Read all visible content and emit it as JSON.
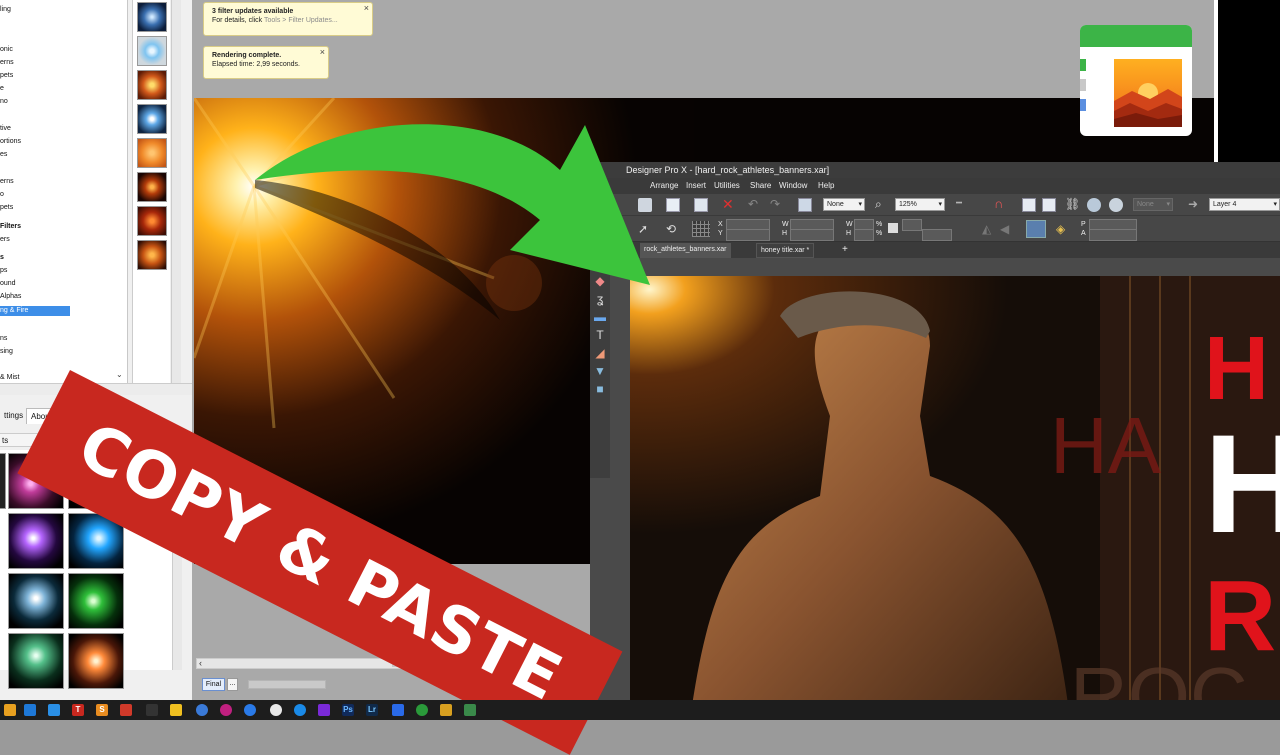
{
  "left_panel": {
    "categories": [
      {
        "label": "ling"
      },
      {
        "label": "onic"
      },
      {
        "label": "erns"
      },
      {
        "label": "pets"
      },
      {
        "label": "e"
      },
      {
        "label": "no"
      },
      {
        "label": "tive"
      },
      {
        "label": "ortions"
      },
      {
        "label": "es"
      },
      {
        "label": "erns"
      },
      {
        "label": "o"
      },
      {
        "label": "pets"
      },
      {
        "label": "Filters"
      },
      {
        "label": "ers"
      },
      {
        "label": "s"
      },
      {
        "label": "ps"
      },
      {
        "label": "ound"
      },
      {
        "label": "Alphas"
      },
      {
        "label": "ng & Fire"
      },
      {
        "label": "ns"
      },
      {
        "label": "sing"
      },
      {
        "label": "& Mist"
      }
    ],
    "tabs": {
      "settings": "ttings",
      "about": "About"
    },
    "presets_label": "ts"
  },
  "notifications": [
    {
      "title": "3 filter updates available",
      "body": "For details, click ",
      "link": "Tools > Filter Updates..."
    },
    {
      "title": "Rendering complete.",
      "body": "Elapsed time: 2,99 seconds."
    }
  ],
  "bottom_bar": {
    "final_label": "Final",
    "more_label": "..."
  },
  "designer": {
    "title": "Designer Pro X - [hard_rock_athletes_banners.xar]",
    "menu": [
      "Arrange",
      "Insert",
      "Utilities",
      "Share",
      "Window",
      "Help"
    ],
    "toolbar": {
      "feather_value": "None",
      "zoom_value": "125%",
      "quality_value": "None",
      "layer_value": "Layer 4"
    },
    "infobar": {
      "x_label": "X",
      "y_label": "Y",
      "w_label": "W",
      "h_label": "H",
      "w2_label": "W",
      "h2_label": "H",
      "pct1": "%",
      "pct2": "%",
      "p_label": "P",
      "a_label": "A"
    },
    "doc_tabs": [
      "rock_athletes_banners.xar",
      "honey title.xar *"
    ],
    "new_tab_label": "+",
    "canvas_letters": {
      "top": "H",
      "mid_red": "HA",
      "white": "H",
      "right_red": "R",
      "bottom": "ROC"
    }
  },
  "banner": {
    "text": "COPY & PASTE"
  },
  "colors": {
    "banner": "#c8281f",
    "arrow": "#3cc43c",
    "selection": "#3d8ee8"
  }
}
